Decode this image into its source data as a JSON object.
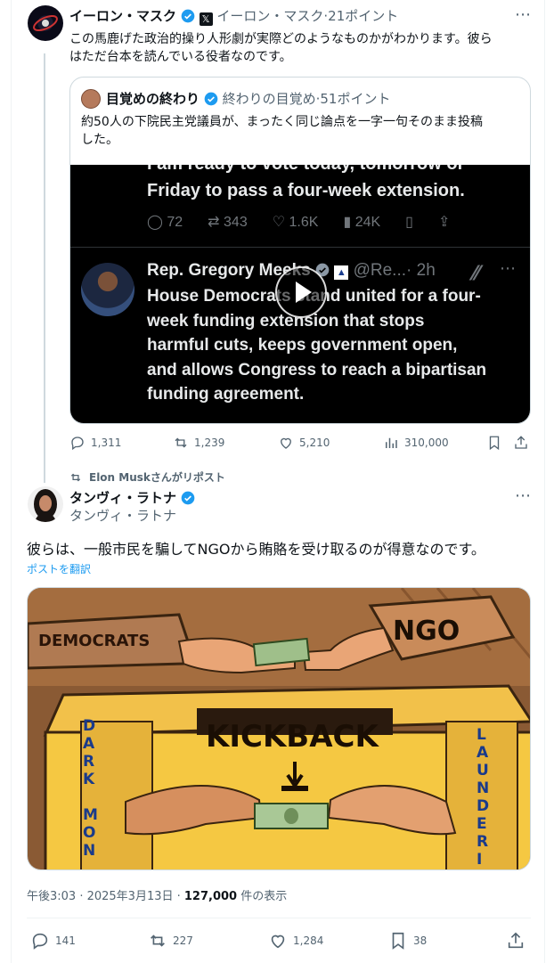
{
  "post1": {
    "author_name": "イーロン・マスク",
    "author_handle": "イーロン・マスク",
    "points": "21ポイント",
    "text_line1": "この馬鹿げた政治的操り人形劇が実際どのようなものかがわかります。彼ら",
    "text_line2": "はただ台本を読んでいる役者なのです。",
    "quote": {
      "author_name": "目覚めの終わり",
      "author_handle": "終わりの目覚め",
      "points": "51ポイント",
      "text_line1": "約50人の下院民主党議員が、まったく同じ論点を一字一句そのまま投稿",
      "text_line2": "した。",
      "embedded": {
        "partial_line": "I am ready to vote today, tomorrow or",
        "line2": "Friday to pass a four-week extension.",
        "replies": "72",
        "reposts": "343",
        "likes": "1.6K",
        "views": "24K",
        "author": "Rep. Gregory Meeks",
        "handle": "@Re...",
        "time": "· 2h",
        "body": [
          "House Democrats stand united for a four-",
          "week funding extension that stops",
          "harmful cuts, keeps government open,",
          "and allows Congress to reach a bipartisan",
          "funding agreement."
        ]
      }
    },
    "actions": {
      "replies": "1,311",
      "reposts": "1,239",
      "likes": "5,210",
      "views": "310,000"
    }
  },
  "repost_label": "Elon Muskさんがリポスト",
  "post2": {
    "author_name": "タンヴィ・ラトナ",
    "author_handle": "タンヴィ・ラトナ",
    "text": "彼らは、一般市民を騙してNGOから賄賂を受け取るのが得意なのです。",
    "translate_label": "ポストを翻訳",
    "meme": {
      "democrats": "DEMOCRATS",
      "ngo": "NGO",
      "kickback": "KICKBACK",
      "dark_money": [
        "D",
        "A",
        "R",
        "K",
        "",
        "M",
        "O",
        "N"
      ],
      "laundering": [
        "L",
        "A",
        "U",
        "N",
        "D",
        "E",
        "R",
        "I"
      ]
    },
    "timestamp": "午後3:03 · 2025年3月13日 · ",
    "views_count": "127,000",
    "views_label": " 件の表示",
    "actions": {
      "replies": "141",
      "reposts": "227",
      "likes": "1,284",
      "bookmarks": "38"
    }
  },
  "colors": {
    "verified": "#1d9bf0",
    "link": "#1d9bf0",
    "muted": "#536471"
  }
}
